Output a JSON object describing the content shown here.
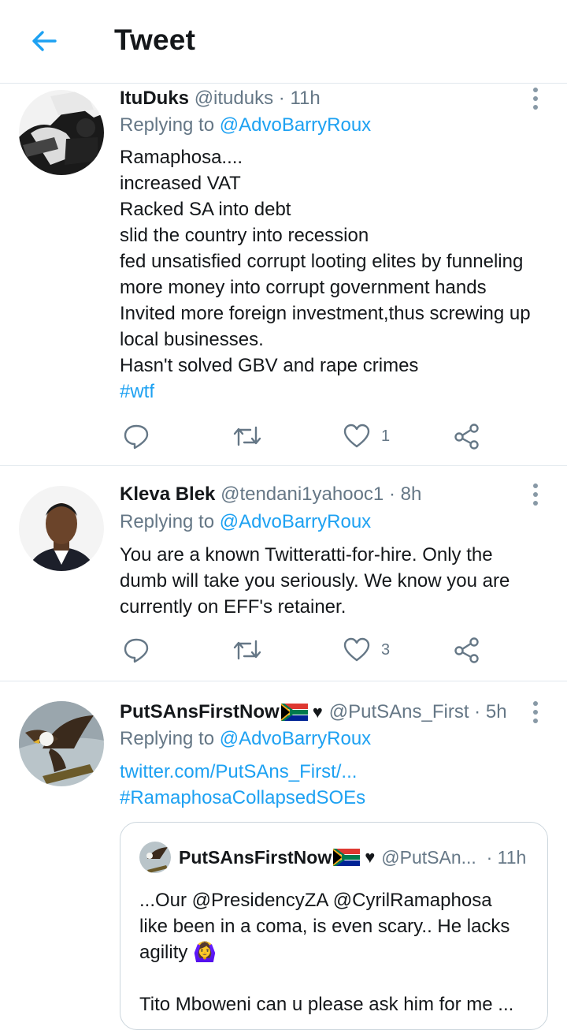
{
  "header": {
    "title": "Tweet"
  },
  "colors": {
    "accent": "#1da1f2",
    "secondary_text": "#657786",
    "divider": "#e1e8ed"
  },
  "tweets": [
    {
      "name": "ItuDuks",
      "handle": "@ituduks",
      "sep": "·",
      "time": "11h",
      "reply_prefix": "Replying to ",
      "reply_to": "@AdvoBarryRoux",
      "lines": [
        "Ramaphosa....",
        "increased VAT",
        "Racked SA into debt",
        "slid the country into recession",
        "fed unsatisfied corrupt looting elites by funneling",
        "more money into corrupt government hands",
        "Invited more foreign investment,thus screwing up",
        "local businesses.",
        "Hasn't solved GBV and rape crimes"
      ],
      "hashtag": "#wtf",
      "like_count": "1"
    },
    {
      "name": "Kleva Blek",
      "handle": "@tendani1yahooc1",
      "sep": "·",
      "time": "8h",
      "reply_prefix": "Replying to ",
      "reply_to": "@AdvoBarryRoux",
      "lines": [
        "You are a known Twitteratti-for-hire. Only the",
        "dumb will take you seriously. We know you are",
        "currently on EFF's retainer."
      ],
      "like_count": "3"
    },
    {
      "name": "PutSAnsFirstNow",
      "heart": "♥",
      "handle": "@PutSAns_First",
      "sep": "·",
      "time": "5h",
      "reply_prefix": "Replying to ",
      "reply_to": "@AdvoBarryRoux",
      "link": "twitter.com/PutSAns_First/...",
      "hashtag": "#RamaphosaCollapsedSOEs",
      "quote": {
        "name": "PutSAnsFirstNow",
        "heart": "♥",
        "handle": "@PutSAn...",
        "sep": "·",
        "time": "11h",
        "lines": [
          "...Our @PresidencyZA @CyrilRamaphosa",
          "like been in a coma, is even scary.. He lacks",
          "agility 🙆‍♀️",
          "",
          "Tito Mboweni can u please ask him for me ..."
        ]
      }
    }
  ]
}
